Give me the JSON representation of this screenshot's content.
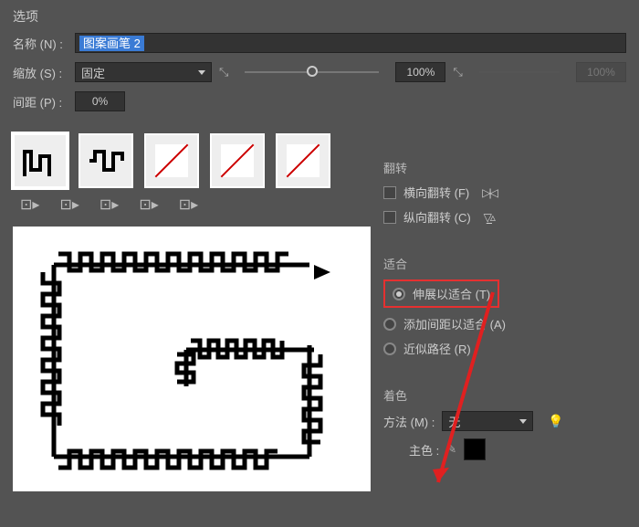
{
  "options": {
    "title": "选项",
    "name_label": "名称 (N) :",
    "name_value": "图案画笔 2",
    "scale_label": "缩放 (S) :",
    "scale_mode": "固定",
    "scale_percent": "100%",
    "scale_percent_disabled": "100%",
    "spacing_label": "间距 (P) :",
    "spacing_value": "0%"
  },
  "flip": {
    "title": "翻转",
    "horizontal": "横向翻转 (F)",
    "vertical": "纵向翻转 (C)"
  },
  "fit": {
    "title": "适合",
    "stretch": "伸展以适合 (T)",
    "add_space": "添加间距以适合 (A)",
    "approx_path": "近似路径 (R)"
  },
  "colorize": {
    "title": "着色",
    "method_label": "方法 (M) :",
    "method_value": "无",
    "key_color_label": "主色 :"
  }
}
